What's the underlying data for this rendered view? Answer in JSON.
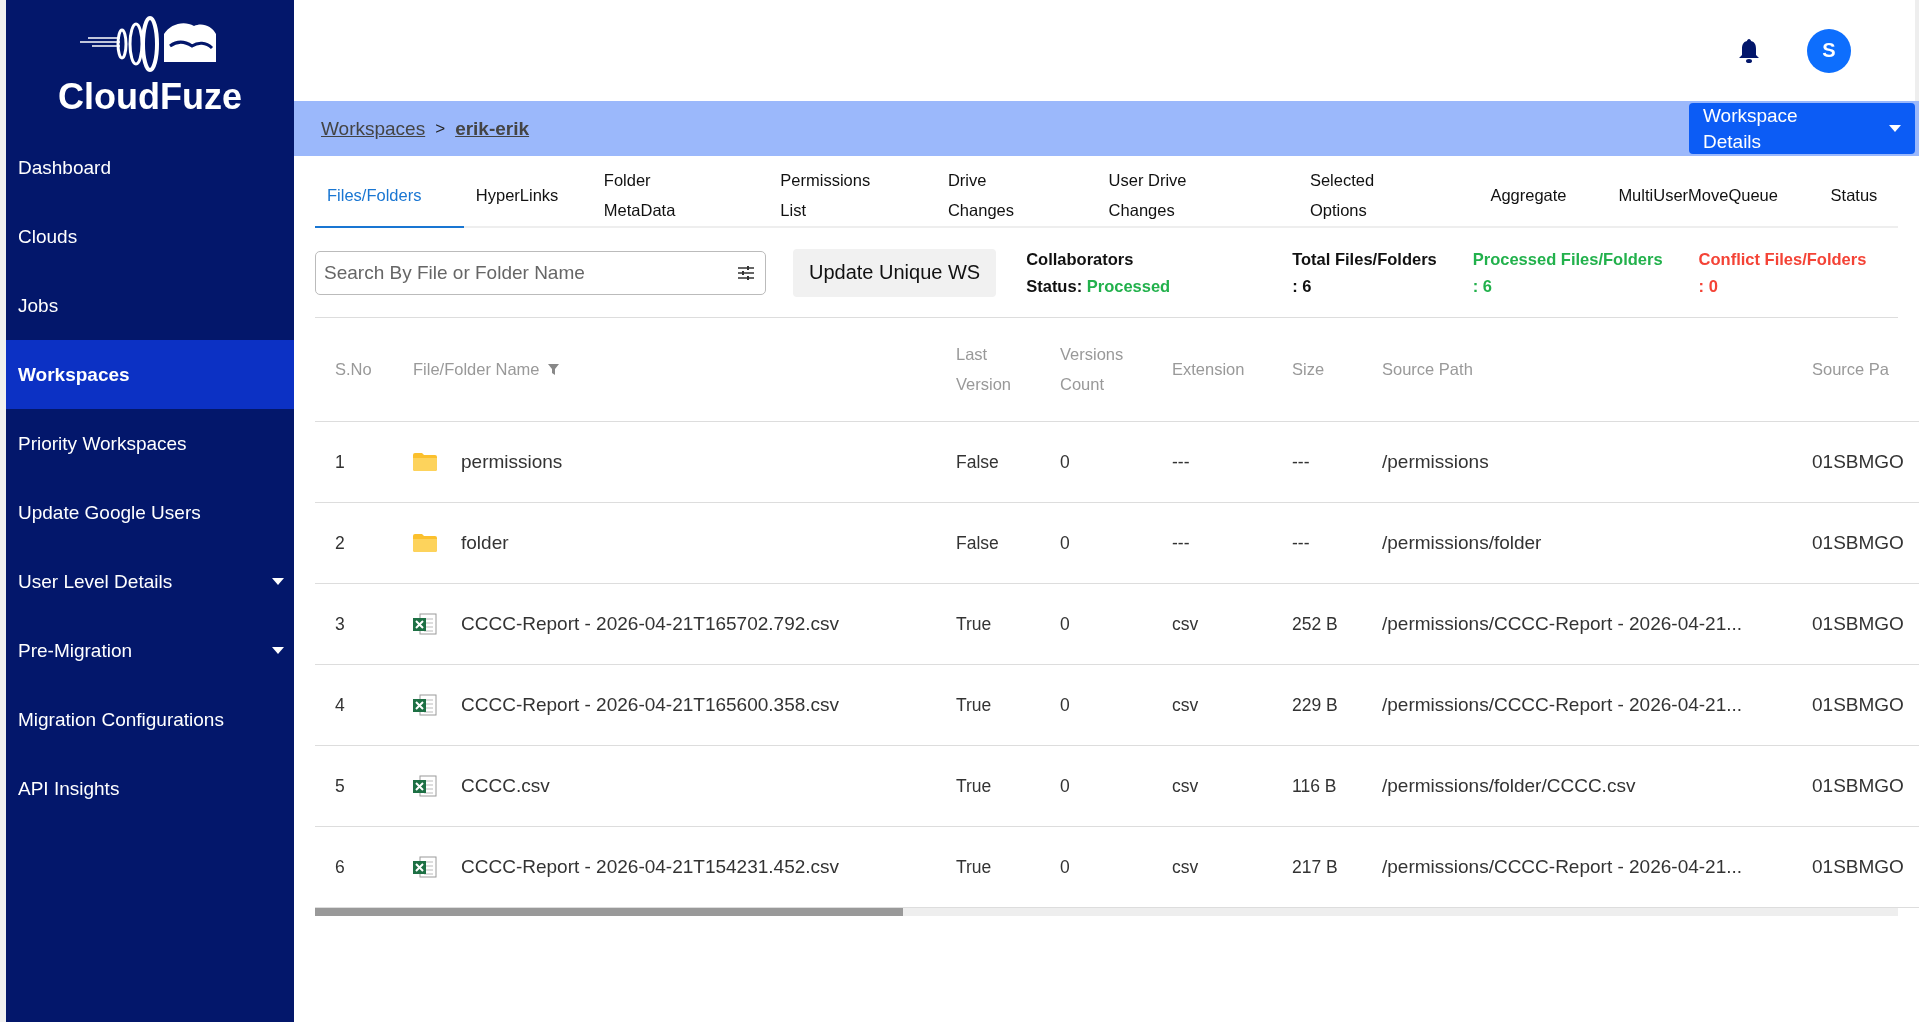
{
  "logo": {
    "text": "CloudFuze"
  },
  "sidebar": {
    "items": [
      {
        "label": "Dashboard",
        "selected": false,
        "expandable": false
      },
      {
        "label": "Clouds",
        "selected": false,
        "expandable": false
      },
      {
        "label": "Jobs",
        "selected": false,
        "expandable": false
      },
      {
        "label": "Workspaces",
        "selected": true,
        "expandable": false
      },
      {
        "label": "Priority Workspaces",
        "selected": false,
        "expandable": false
      },
      {
        "label": "Update Google Users",
        "selected": false,
        "expandable": false
      },
      {
        "label": "User Level Details",
        "selected": false,
        "expandable": true
      },
      {
        "label": "Pre-Migration",
        "selected": false,
        "expandable": true
      },
      {
        "label": "Migration Configurations",
        "selected": false,
        "expandable": false
      },
      {
        "label": "API Insights",
        "selected": false,
        "expandable": false
      }
    ]
  },
  "header": {
    "avatar": "S"
  },
  "breadcrumb": {
    "items": [
      "Workspaces",
      "erik-erik"
    ],
    "separator": ">"
  },
  "workspace_button": "Workspace Details",
  "tabs": [
    {
      "label": "Files/Folders",
      "selected": true
    },
    {
      "label": "HyperLinks",
      "selected": false
    },
    {
      "label": "Folder MetaData",
      "selected": false
    },
    {
      "label": "Permissions List",
      "selected": false
    },
    {
      "label": "Drive Changes",
      "selected": false
    },
    {
      "label": "User Drive Changes",
      "selected": false
    },
    {
      "label": "Selected Options",
      "selected": false
    },
    {
      "label": "Aggregate",
      "selected": false
    },
    {
      "label": "MultiUserMoveQueue",
      "selected": false
    },
    {
      "label": "Status",
      "selected": false
    }
  ],
  "search": {
    "placeholder": "Search By File or Folder Name"
  },
  "update_button": "Update Unique WS",
  "collaborators": {
    "title": "Collaborators",
    "status_label": "Status:",
    "status": "Processed"
  },
  "stats": [
    {
      "label": "Total Files/Folders",
      "value": ": 6",
      "color": "#111111"
    },
    {
      "label": "Processed Files/Folders",
      "value": ": 6",
      "color": "#22b14c"
    },
    {
      "label": "Conflict Files/Folders",
      "value": ": 0",
      "color": "#f44336"
    }
  ],
  "table": {
    "columns": [
      "S.No",
      "File/Folder Name",
      "Last Version",
      "Versions Count",
      "Extension",
      "Size",
      "Source Path",
      "Source Pa"
    ],
    "rows": [
      {
        "kind": "folder",
        "cells": [
          "1",
          "permissions",
          "False",
          "0",
          "---",
          "---",
          "/permissions",
          "01SBMGO"
        ]
      },
      {
        "kind": "folder",
        "cells": [
          "2",
          "folder",
          "False",
          "0",
          "---",
          "---",
          "/permissions/folder",
          "01SBMGO"
        ]
      },
      {
        "kind": "file",
        "cells": [
          "3",
          "CCCC-Report - 2026-04-21T165702.792.csv",
          "True",
          "0",
          "csv",
          "252 B",
          "/permissions/CCCC-Report - 2026-04-21...",
          "01SBMGO"
        ]
      },
      {
        "kind": "file",
        "cells": [
          "4",
          "CCCC-Report - 2026-04-21T165600.358.csv",
          "True",
          "0",
          "csv",
          "229 B",
          "/permissions/CCCC-Report - 2026-04-21...",
          "01SBMGO"
        ]
      },
      {
        "kind": "file",
        "cells": [
          "5",
          "CCCC.csv",
          "True",
          "0",
          "csv",
          "116 B",
          "/permissions/folder/CCCC.csv",
          "01SBMGO"
        ]
      },
      {
        "kind": "file",
        "cells": [
          "6",
          "CCCC-Report - 2026-04-21T154231.452.csv",
          "True",
          "0",
          "csv",
          "217 B",
          "/permissions/CCCC-Report - 2026-04-21...",
          "01SBMGO"
        ]
      }
    ]
  }
}
